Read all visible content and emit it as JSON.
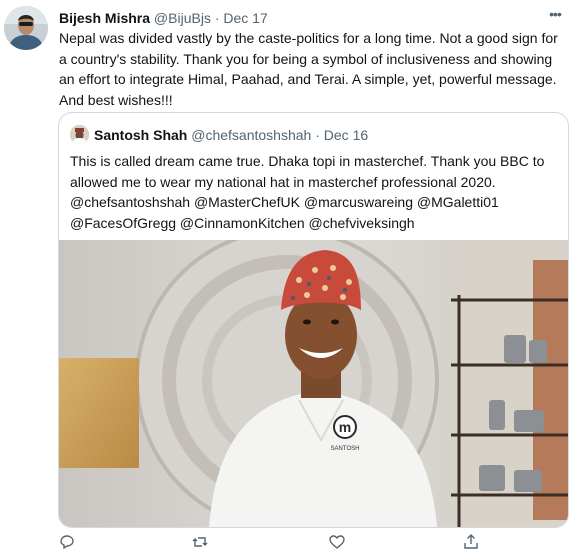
{
  "tweet": {
    "author_name": "Bijesh Mishra",
    "author_handle": "@BijuBjs",
    "separator": "·",
    "date": "Dec 17",
    "more_label": "•••",
    "text": "Nepal was divided vastly by the caste-politics for a long time. Not a good sign for a country's stability. Thank you for being a symbol of inclusiveness and showing an effort to integrate Himal, Paahad, and Terai. A simple, yet, powerful message. And best wishes!!!"
  },
  "quoted_tweet": {
    "author_name": "Santosh Shah",
    "author_handle": "@chefsantoshshah",
    "separator": "·",
    "date": "Dec 16",
    "text": "This is called dream came true. Dhaka topi in masterchef. Thank you BBC to allowed me to wear my national hat in masterchef professional 2020. @chefsantoshshah @MasterChefUK @marcuswareing @MGaletti01 @FacesOfGregg @CinnamonKitchen @chefviveksingh",
    "photo": {
      "jacket_name": "SANTOSH",
      "logo_letter": "m"
    }
  },
  "actions": {
    "icons": [
      "reply-icon",
      "retweet-icon",
      "like-icon",
      "share-icon"
    ]
  }
}
